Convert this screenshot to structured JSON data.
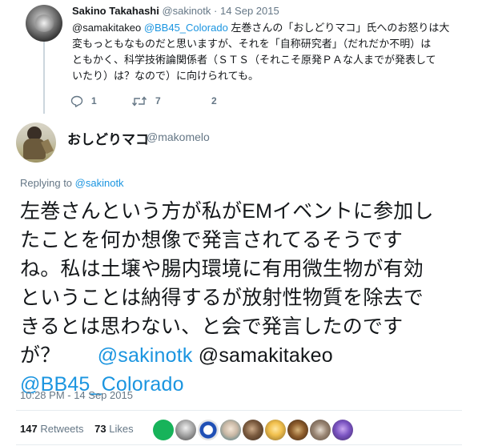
{
  "parent_tweet": {
    "name": "Sakino Takahashi",
    "handle": "@sakinotk",
    "separator": "·",
    "date": "14 Sep 2015",
    "text_mention_1": "@samakitakeo",
    "text_mention_2": "@BB45_Colorado",
    "text_line_1": "左巻さんの「おしどりマコ」氏へのお怒りは大",
    "text_line_2": "変もっともなものだと思いますが、それを「自称研究者」（だれだか不明）は",
    "text_line_3": "ともかく、科学技術論関係者（ＳＴＳ（それこそ原発ＰＡな人までが発表して",
    "text_line_4": "いたり）は？なので）に向けられても。",
    "reply_count": "1",
    "retweet_count": "7",
    "like_count": "2"
  },
  "main_tweet": {
    "display_name": "おしどりマコ",
    "handle": "@makomelo",
    "replying_label": "Replying to",
    "replying_to": "@sakinotk",
    "text_line_1": "左巻さんという方が私がEMイベントに参加し",
    "text_line_2": "たことを何か想像で発言されてるそうです",
    "text_line_3": "ね。私は土壌や腸内環境に有用微生物が有効",
    "text_line_4": "ということは納得するが放射性物質を除去で",
    "text_line_5": "きるとは思わない、と会で発言したのです",
    "text_line_6_prefix": "が？",
    "mention_1": "@sakinotk",
    "mention_2": "@samakitakeo",
    "mention_3": "@BB45_Colorado",
    "timestamp": "10:28 PM - 14 Sep 2015",
    "retweets_count": "147",
    "retweets_label": "Retweets",
    "likes_count": "73",
    "likes_label": "Likes"
  },
  "icons": {
    "reply": "reply-icon",
    "retweet": "retweet-icon",
    "like": "heart-icon"
  },
  "colors": {
    "link": "#1b95e0",
    "muted": "#657786",
    "text": "#14171a",
    "thread_line": "#ccd6dd"
  }
}
